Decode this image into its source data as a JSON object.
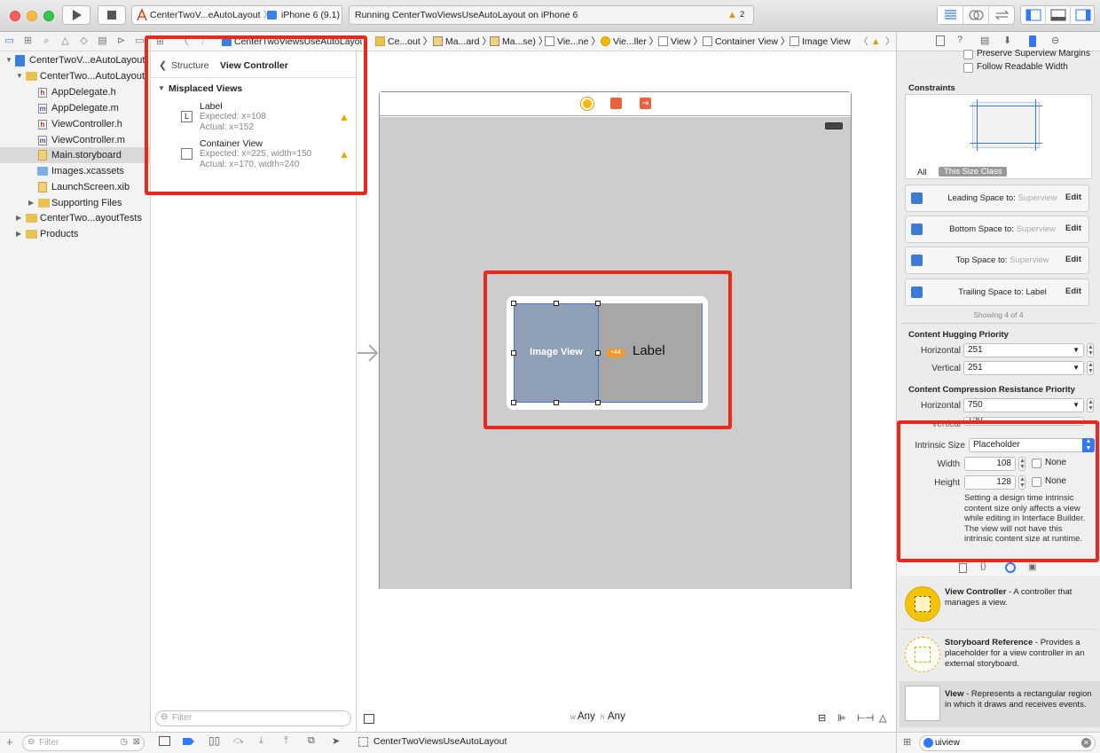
{
  "toolbar": {
    "scheme": "CenterTwoV...eAutoLayout",
    "device": "iPhone 6 (9.1)",
    "status": "Running CenterTwoViewsUseAutoLayout on iPhone 6",
    "warnings": "2"
  },
  "navigator": {
    "items": [
      {
        "label": "CenterTwoV...eAutoLayout"
      },
      {
        "label": "CenterTwo...AutoLayout"
      },
      {
        "label": "AppDelegate.h",
        "badge": "h"
      },
      {
        "label": "AppDelegate.m",
        "badge": "m"
      },
      {
        "label": "ViewController.h",
        "badge": "h"
      },
      {
        "label": "ViewController.m",
        "badge": "m"
      },
      {
        "label": "Main.storyboard"
      },
      {
        "label": "Images.xcassets"
      },
      {
        "label": "LaunchScreen.xib"
      },
      {
        "label": "Supporting Files"
      },
      {
        "label": "CenterTwo...ayoutTests"
      },
      {
        "label": "Products"
      }
    ],
    "filter_placeholder": "Filter"
  },
  "jumpbar": {
    "segments": [
      "CenterTwoViewsUseAutoLayout",
      "Ce...out",
      "Ma...ard",
      "Ma...se)",
      "Vie...ne",
      "Vie...ller",
      "View",
      "Container View",
      "Image View"
    ]
  },
  "issues": {
    "back_label": "Structure",
    "title": "View Controller",
    "section": "Misplaced Views",
    "items": [
      {
        "badge": "L",
        "name": "Label",
        "expected": "Expected: x=108",
        "actual": "Actual: x=152"
      },
      {
        "badge": "",
        "name": "Container View",
        "expected": "Expected: x=225, width=150",
        "actual": "Actual: x=170, width=240"
      }
    ],
    "filter_placeholder": "Filter"
  },
  "canvas": {
    "image_view_label": "Image View",
    "label_text": "Label",
    "badge": "+44",
    "size_w_prefix": "w",
    "size_w": "Any",
    "size_h_prefix": "h",
    "size_h": "Any"
  },
  "inspector": {
    "preserve_margins": "Preserve Superview Margins",
    "follow_readable": "Follow Readable Width",
    "constraints_title": "Constraints",
    "tab_all": "All",
    "tab_size_class": "This Size Class",
    "constraints": [
      {
        "label": "Leading Space to:",
        "target": "Superview",
        "edit": "Edit"
      },
      {
        "label": "Bottom Space to:",
        "target": "Superview",
        "edit": "Edit"
      },
      {
        "label": "Top Space to:",
        "target": "Superview",
        "edit": "Edit"
      },
      {
        "label": "Trailing Space to:",
        "target": "Label",
        "edit": "Edit"
      }
    ],
    "showing": "Showing 4 of 4",
    "hugging_title": "Content Hugging Priority",
    "hugging_h_label": "Horizontal",
    "hugging_h": "251",
    "hugging_v_label": "Vertical",
    "hugging_v": "251",
    "compression_title": "Content Compression Resistance Priority",
    "compression_h_label": "Horizontal",
    "compression_h": "750",
    "compression_v_label": "Vertical",
    "compression_v": "750",
    "intrinsic_label": "Intrinsic Size",
    "intrinsic_value": "Placeholder",
    "width_label": "Width",
    "width_value": "108",
    "height_label": "Height",
    "height_value": "128",
    "none_label": "None",
    "note": "Setting a design time intrinsic content size only affects a view while editing in Interface Builder. The view will not have this intrinsic content size at runtime."
  },
  "library": {
    "items": [
      {
        "title": "View Controller",
        "desc": " - A controller that manages a view."
      },
      {
        "title": "Storyboard Reference",
        "desc": " - Provides a placeholder for a view controller in an external storyboard."
      },
      {
        "title": "View",
        "desc": " - Represents a rectangular region in which it draws and receives events."
      }
    ],
    "search": "uiview"
  },
  "debugbar": {
    "target": "CenterTwoViewsUseAutoLayout"
  },
  "colors": {
    "accent": "#3478f6",
    "warning": "#f5b800",
    "highlight": "#e8291c",
    "image_view": "#8fa0b6",
    "label_bg": "#a7a7a7"
  }
}
